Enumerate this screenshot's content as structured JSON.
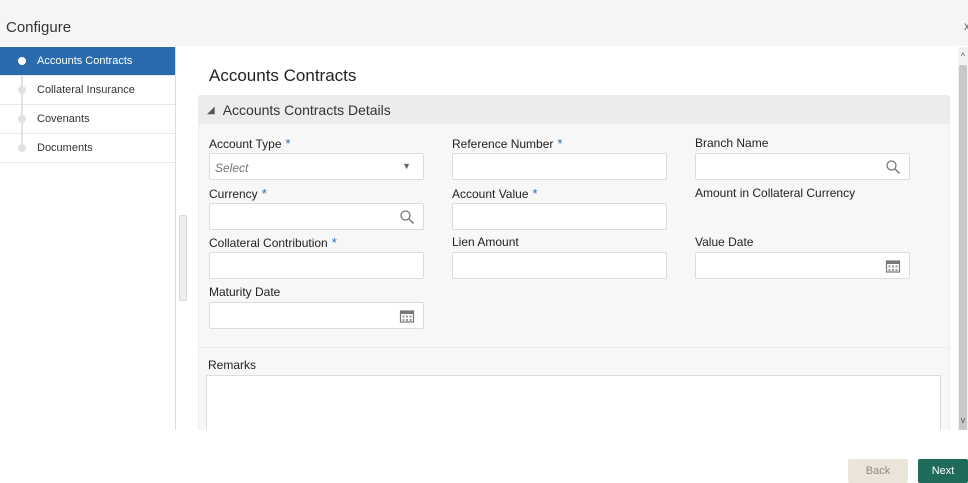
{
  "window": {
    "title": "Configure",
    "close_label": "x"
  },
  "sidebar": {
    "items": [
      {
        "label": "Accounts Contracts",
        "active": true
      },
      {
        "label": "Collateral Insurance",
        "active": false
      },
      {
        "label": "Covenants",
        "active": false
      },
      {
        "label": "Documents",
        "active": false
      }
    ]
  },
  "main": {
    "heading": "Accounts Contracts",
    "section_title": "Accounts Contracts Details",
    "fields": {
      "account_type": {
        "label": "Account Type",
        "required": "*",
        "placeholder": "Select"
      },
      "reference_number": {
        "label": "Reference Number",
        "required": "*"
      },
      "branch_name": {
        "label": "Branch Name"
      },
      "currency": {
        "label": "Currency",
        "required": "*"
      },
      "account_value": {
        "label": "Account Value",
        "required": "*"
      },
      "amount_in_collateral_currency": {
        "label": "Amount in Collateral Currency"
      },
      "collateral_contribution": {
        "label": "Collateral Contribution",
        "required": "*"
      },
      "lien_amount": {
        "label": "Lien Amount"
      },
      "value_date": {
        "label": "Value Date"
      },
      "maturity_date": {
        "label": "Maturity Date"
      }
    },
    "remarks_label": "Remarks"
  },
  "footer": {
    "back_label": "Back",
    "next_label": "Next"
  },
  "colors": {
    "accent": "#2a6bad",
    "next_button": "#1f6b5a",
    "back_button": "#ebe4d9"
  }
}
